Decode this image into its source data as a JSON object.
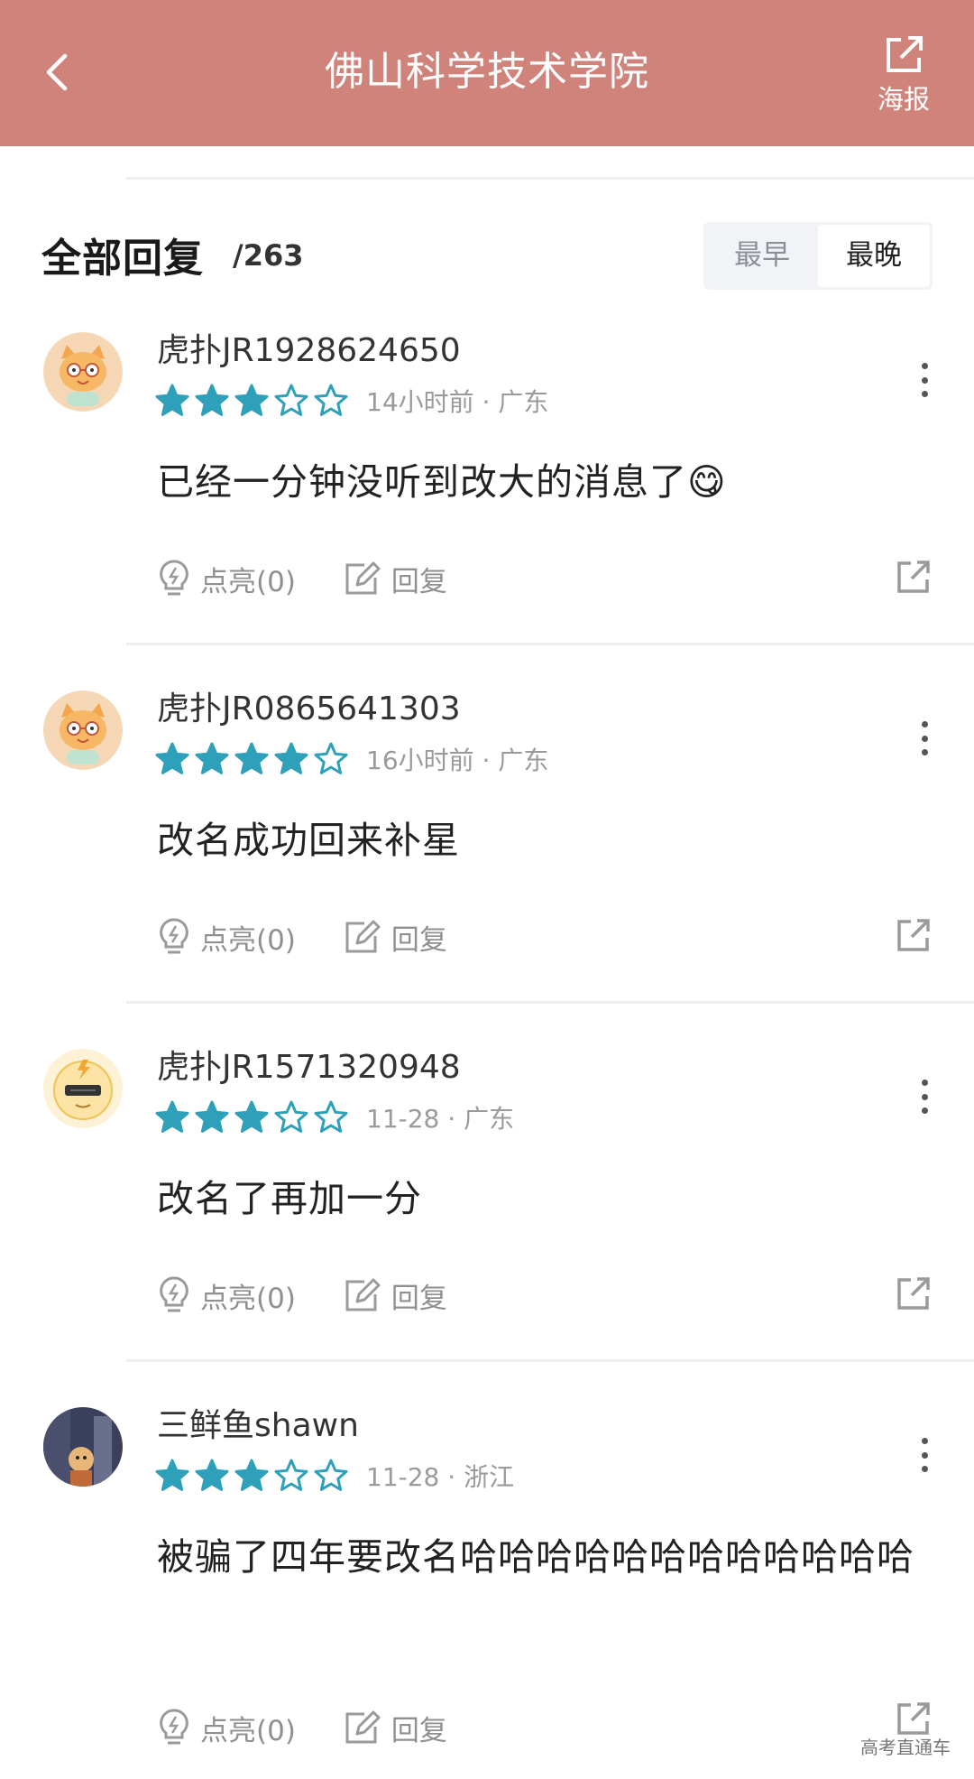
{
  "header": {
    "title": "佛山科学技术学院",
    "poster_label": "海报",
    "bg_color": "#d0837b"
  },
  "replies": {
    "title": "全部回复",
    "count": "/263",
    "sort": {
      "earliest": "最早",
      "latest": "最晚",
      "selected": "最晚"
    }
  },
  "comments": [
    {
      "username": "虎扑JR1928624650",
      "rating": 3,
      "max_rating": 5,
      "time_location": "14小时前 · 广东",
      "content": "已经一分钟没听到改大的消息了😋",
      "like_label": "点亮(0)",
      "reply_label": "回复",
      "avatar": "cat-avatar-icon"
    },
    {
      "username": "虎扑JR0865641303",
      "rating": 4,
      "max_rating": 5,
      "time_location": "16小时前 · 广东",
      "content": "改名成功回来补星",
      "like_label": "点亮(0)",
      "reply_label": "回复",
      "avatar": "cat-avatar-icon"
    },
    {
      "username": "虎扑JR1571320948",
      "rating": 3,
      "max_rating": 5,
      "time_location": "11-28 · 广东",
      "content": "改名了再加一分",
      "like_label": "点亮(0)",
      "reply_label": "回复",
      "avatar": "sunglasses-avatar-icon"
    },
    {
      "username": "三鲜鱼shawn",
      "rating": 3,
      "max_rating": 5,
      "time_location": "11-28 · 浙江",
      "content": "被骗了四年要改名哈哈哈哈哈哈哈哈哈哈哈哈",
      "like_label": "点亮(0)",
      "reply_label": "回复",
      "avatar": "photo-avatar"
    }
  ],
  "watermark": "高考直通车",
  "colors": {
    "star": "#2fa0ba",
    "meta": "#9a9a9a"
  }
}
